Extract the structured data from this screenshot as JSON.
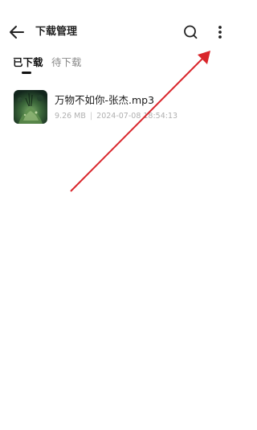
{
  "header": {
    "title": "下载管理",
    "back_icon": "arrow-left-icon",
    "search_icon": "search-icon",
    "more_icon": "more-vertical-icon"
  },
  "tabs": [
    {
      "label": "已下载",
      "active": true
    },
    {
      "label": "待下载",
      "active": false
    }
  ],
  "downloads": [
    {
      "name": "万物不如你-张杰.mp3",
      "size": "9.26 MB",
      "separator": "|",
      "date": "2024-07-08 18:54:13",
      "thumbnail_icon": "album-art-image"
    }
  ],
  "colors": {
    "annotation_arrow": "#d9252b",
    "meta_text": "#b0b0b0",
    "inactive_tab": "#8a8a8a"
  }
}
